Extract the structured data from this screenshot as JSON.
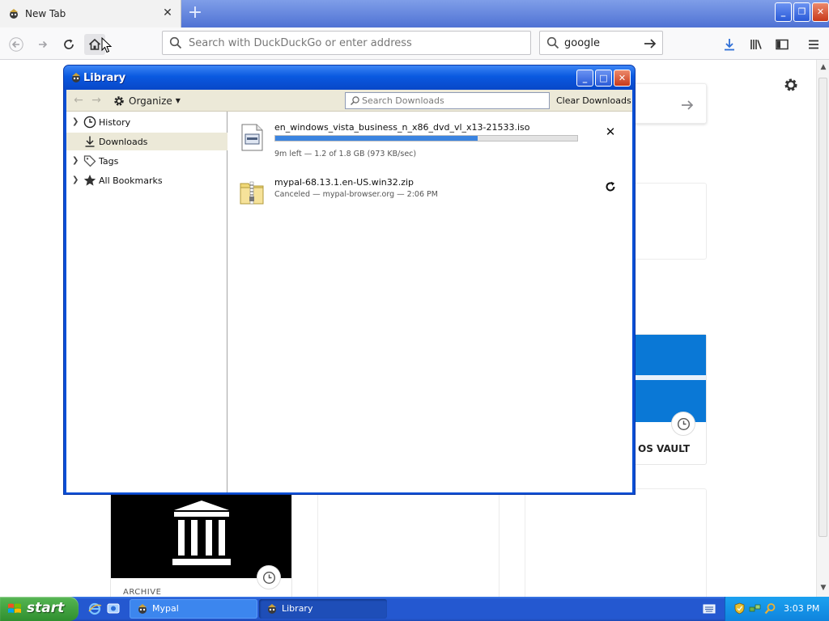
{
  "browser": {
    "tab_title": "New Tab",
    "url_placeholder": "Search with DuckDuckGo or enter address",
    "search_value": "google"
  },
  "newtab": {
    "vault_label": "OS VAULT",
    "archive_label": "ARCHIVE"
  },
  "library": {
    "title": "Library",
    "organize_label": "Organize",
    "search_placeholder": "Search Downloads",
    "clear_label": "Clear Downloads",
    "sidebar": [
      {
        "label": "History"
      },
      {
        "label": "Downloads"
      },
      {
        "label": "Tags"
      },
      {
        "label": "All Bookmarks"
      }
    ],
    "downloads": [
      {
        "name": "en_windows_vista_business_n_x86_dvd_vl_x13-21533.iso",
        "status": "9m left — 1.2 of 1.8 GB (973 KB/sec)",
        "progress": 0.67
      },
      {
        "name": "mypal-68.13.1.en-US.win32.zip",
        "status": "Canceled — mypal-browser.org — 2:06 PM"
      }
    ]
  },
  "taskbar": {
    "start_label": "start",
    "tasks": [
      {
        "label": "Mypal"
      },
      {
        "label": "Library"
      }
    ],
    "clock": "3:03 PM"
  },
  "colors": {
    "xp_blue": "#0a4fd6",
    "progress": "#3b84e0",
    "start_green": "#3a9d3a"
  }
}
